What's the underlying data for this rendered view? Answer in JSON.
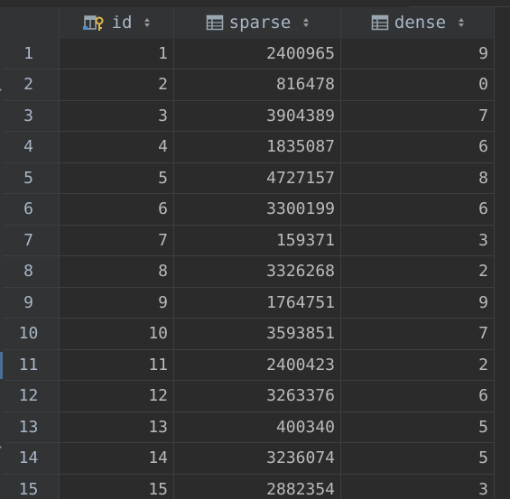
{
  "columns": {
    "id": {
      "label": "id",
      "icon": "primary-key-column-icon"
    },
    "sparse": {
      "label": "sparse",
      "icon": "table-column-icon"
    },
    "dense": {
      "label": "dense",
      "icon": "table-column-icon"
    }
  },
  "rows": [
    {
      "num": "1",
      "id": "1",
      "sparse": "2400965",
      "dense": "9"
    },
    {
      "num": "2",
      "id": "2",
      "sparse": "816478",
      "dense": "0"
    },
    {
      "num": "3",
      "id": "3",
      "sparse": "3904389",
      "dense": "7"
    },
    {
      "num": "4",
      "id": "4",
      "sparse": "1835087",
      "dense": "6"
    },
    {
      "num": "5",
      "id": "5",
      "sparse": "4727157",
      "dense": "8"
    },
    {
      "num": "6",
      "id": "6",
      "sparse": "3300199",
      "dense": "6"
    },
    {
      "num": "7",
      "id": "7",
      "sparse": "159371",
      "dense": "3"
    },
    {
      "num": "8",
      "id": "8",
      "sparse": "3326268",
      "dense": "2"
    },
    {
      "num": "9",
      "id": "9",
      "sparse": "1764751",
      "dense": "9"
    },
    {
      "num": "10",
      "id": "10",
      "sparse": "3593851",
      "dense": "7"
    },
    {
      "num": "11",
      "id": "11",
      "sparse": "2400423",
      "dense": "2"
    },
    {
      "num": "12",
      "id": "12",
      "sparse": "3263376",
      "dense": "6"
    },
    {
      "num": "13",
      "id": "13",
      "sparse": "400340",
      "dense": "5"
    },
    {
      "num": "14",
      "id": "14",
      "sparse": "3236074",
      "dense": "5"
    },
    {
      "num": "15",
      "id": "15",
      "sparse": "2882354",
      "dense": "3"
    }
  ],
  "colors": {
    "background": "#2b2b2b",
    "header_bg": "#313335",
    "grid_line": "#3c3f41",
    "text": "#bbbbbb",
    "key_icon": "#e0b84a",
    "column_icon": "#9aa7b0"
  }
}
